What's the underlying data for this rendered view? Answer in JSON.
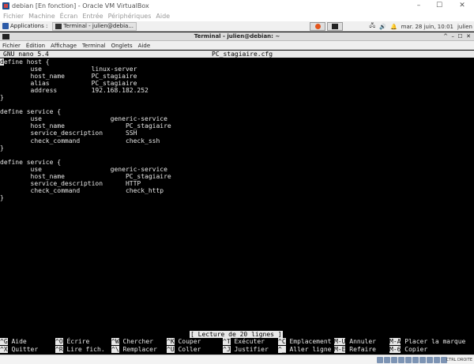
{
  "vbox": {
    "title": "debian [En fonction] - Oracle VM VirtualBox",
    "menu": [
      "Fichier",
      "Machine",
      "Écran",
      "Entrée",
      "Périphériques",
      "Aide"
    ],
    "host_key": "CTRL DROITE"
  },
  "panel": {
    "applications": "Applications :",
    "task": "Terminal - julien@debia...",
    "taskbar_right": "julien",
    "clock": "mar. 28 juin, 10:01"
  },
  "terminal": {
    "title": "Terminal - julien@debian: ~",
    "menu": [
      "Fichier",
      "Édition",
      "Affichage",
      "Terminal",
      "Onglets",
      "Aide"
    ]
  },
  "nano": {
    "version": "GNU nano 5.4",
    "filename": "PC_stagiaire.cfg",
    "first_char": "d",
    "code": "efine host {\n        use             linux-server\n        host_name       PC_stagiaire\n        alias           PC_stagiaire\n        address         192.168.182.252\n}\n\ndefine service {\n        use                  generic-service\n        host_name                PC_stagiaire\n        service_description      SSH\n        check_command            check_ssh\n}\n\ndefine service {\n        use                  generic-service\n        host_name                PC_stagiaire\n        service_description      HTTP\n        check_command            check_http\n}",
    "status": "[ Lecture de 20 lignes ]",
    "shortcuts_row1": [
      {
        "key": "^G",
        "label": "Aide"
      },
      {
        "key": "^O",
        "label": "Écrire"
      },
      {
        "key": "^W",
        "label": "Chercher"
      },
      {
        "key": "^K",
        "label": "Couper"
      },
      {
        "key": "^T",
        "label": "Exécuter"
      },
      {
        "key": "^C",
        "label": "Emplacement"
      },
      {
        "key": "M-U",
        "label": "Annuler"
      },
      {
        "key": "M-A",
        "label": "Placer la marque"
      }
    ],
    "shortcuts_row2": [
      {
        "key": "^X",
        "label": "Quitter"
      },
      {
        "key": "^R",
        "label": "Lire fich."
      },
      {
        "key": "^\\",
        "label": "Remplacer"
      },
      {
        "key": "^U",
        "label": "Coller"
      },
      {
        "key": "^J",
        "label": "Justifier"
      },
      {
        "key": "^_",
        "label": "Aller ligne"
      },
      {
        "key": "M-E",
        "label": "Refaire"
      },
      {
        "key": "M-6",
        "label": "Copier"
      }
    ]
  }
}
